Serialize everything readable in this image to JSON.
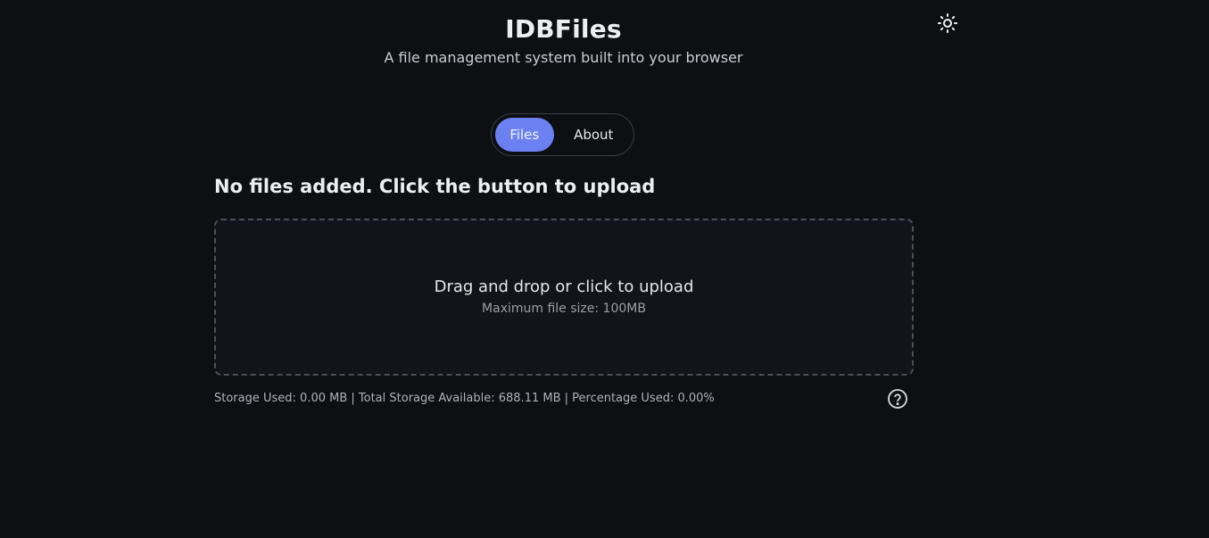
{
  "app": {
    "title": "IDBFiles",
    "subtitle": "A file management system built into your browser"
  },
  "theme_toggle": {
    "icon": "sun-icon"
  },
  "tabs": [
    {
      "label": "Files",
      "active": true
    },
    {
      "label": "About",
      "active": false
    }
  ],
  "main": {
    "empty_message": "No files added. Click the button to upload",
    "dropzone": {
      "title": "Drag and drop or click to upload",
      "hint": "Maximum file size: 100MB"
    },
    "storage_info": "Storage Used: 0.00 MB | Total Storage Available: 688.11 MB | Percentage Used: 0.00%",
    "help_icon": "question-circle-icon"
  },
  "colors": {
    "background": "#0d0f13",
    "accent": "#6b81f2",
    "dropzone_bg": "#11141a",
    "border": "#4a4f59"
  }
}
